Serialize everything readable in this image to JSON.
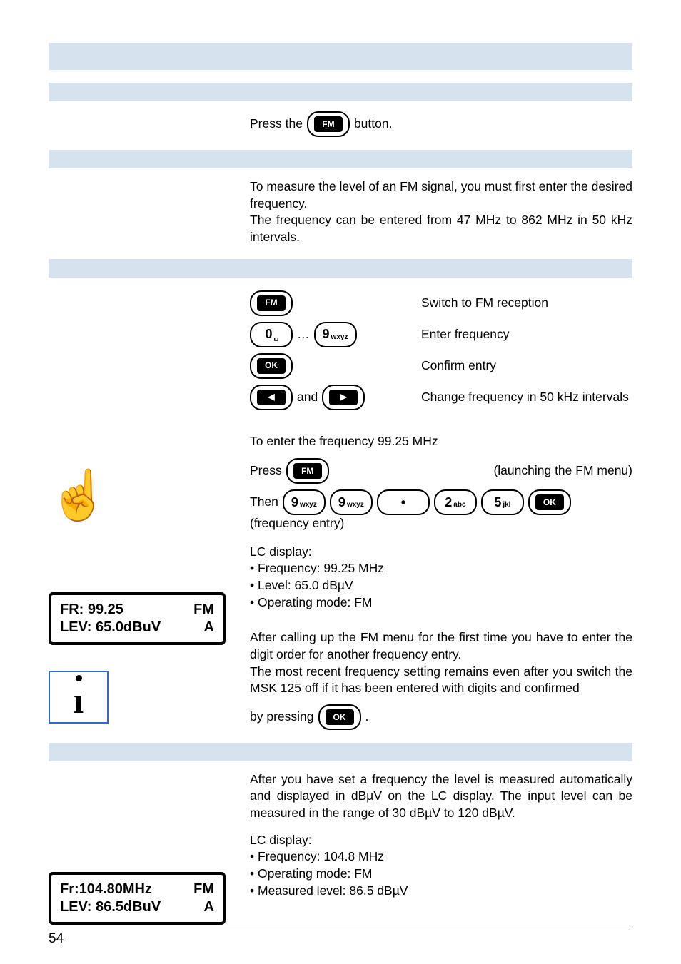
{
  "section1": {
    "press_the": "Press the",
    "button_suffix": "button.",
    "fm_key": "FM"
  },
  "section2": {
    "p1": "To measure the level of an FM signal, you must first enter the desired frequency.",
    "p2": "The frequency can be entered from 47 MHz to 862 MHz in 50 kHz intervals."
  },
  "section3": {
    "keys": {
      "fm": "FM",
      "zero": "0",
      "nine": "9",
      "nine_sub": "wxyz",
      "ok": "OK",
      "and": "and"
    },
    "labels": {
      "switch": "Switch to FM reception",
      "enter": "Enter frequency",
      "confirm": "Confirm entry",
      "change": "Change frequency in 50 kHz intervals"
    },
    "dots": "…"
  },
  "example": {
    "intro": "To enter the frequency 99.25 MHz",
    "press": "Press",
    "launch": "(launching the FM menu)",
    "then": "Then",
    "freq_entry": "(frequency entry)",
    "keys": {
      "fm": "FM",
      "nine": "9",
      "nine_sub": "wxyz",
      "dot": "•",
      "two": "2",
      "two_sub": "abc",
      "five": "5",
      "five_sub": "jkl",
      "ok": "OK"
    }
  },
  "lcd1": {
    "r1l": "FR: 99.25",
    "r1r": "FM",
    "r2l": "LEV: 65.0dBuV",
    "r2r": "A"
  },
  "lcd1_desc": {
    "title": "LC display:",
    "b1": "Frequency: 99.25 MHz",
    "b2": "Level: 65.0 dBµV",
    "b3": "Operating mode: FM"
  },
  "info": {
    "p1": "After calling up the FM menu for the first time you have to enter the digit order for another frequency entry.",
    "p2a": "The most recent frequency setting remains even after you switch the MSK 125 off if it has been entered with digits and confirmed",
    "by_pressing": "by pressing",
    "ok": "OK",
    "period": "."
  },
  "section4": {
    "p1": "After you have set a frequency the level is measured automatically and displayed in dBµV on the LC display. The input level can be measured in the range of 30 dBµV to 120 dBµV."
  },
  "lcd2": {
    "r1l": "Fr:104.80MHz",
    "r1r": "FM",
    "r2l": "LEV: 86.5dBuV",
    "r2r": "A"
  },
  "lcd2_desc": {
    "title": "LC display:",
    "b1": "Frequency: 104.8 MHz",
    "b2": "Operating mode: FM",
    "b3": "Measured level: 86.5 dBµV"
  },
  "page_number": "54"
}
